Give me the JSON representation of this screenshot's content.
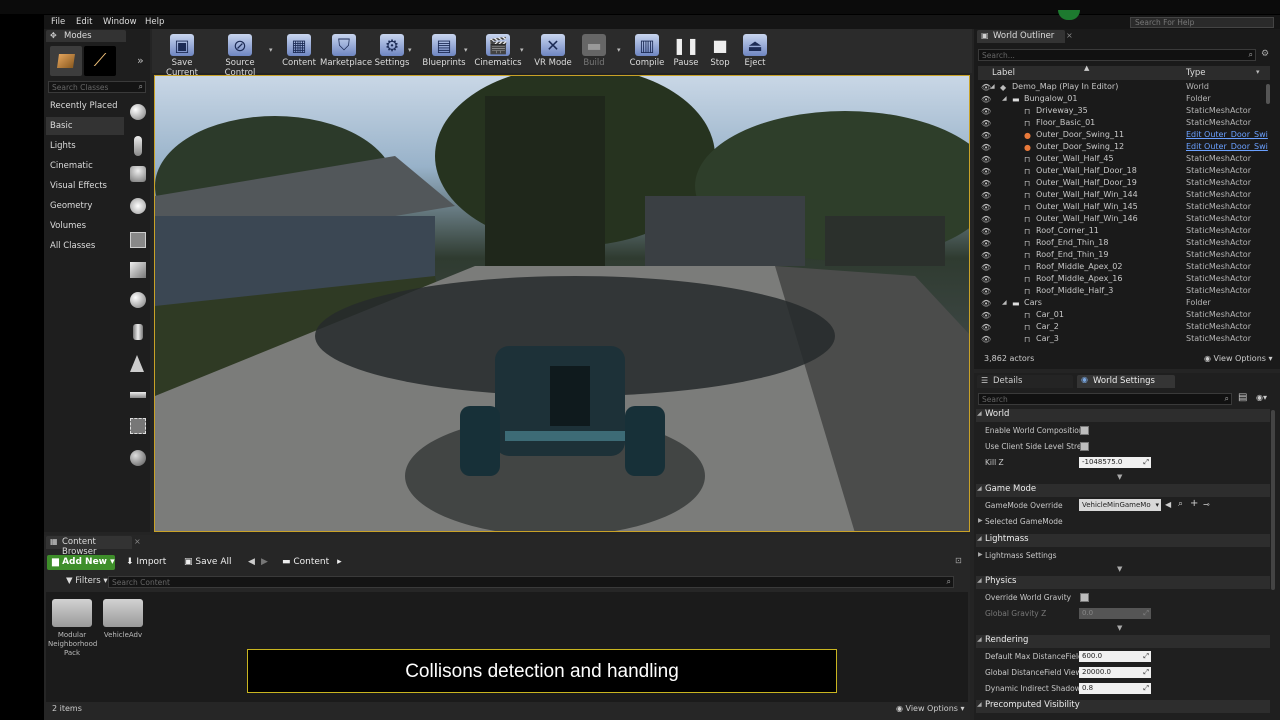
{
  "menu": [
    "File",
    "Edit",
    "Window",
    "Help"
  ],
  "search_help": {
    "placeholder": "Search For Help"
  },
  "modes": {
    "tab": "Modes",
    "search_placeholder": "Search Classes",
    "items": [
      "Recently Placed",
      "Basic",
      "Lights",
      "Cinematic",
      "Visual Effects",
      "Geometry",
      "Volumes",
      "All Classes"
    ]
  },
  "toolbar": {
    "save": "Save Current",
    "source_control": "Source Control",
    "content": "Content",
    "marketplace": "Marketplace",
    "settings": "Settings",
    "blueprints": "Blueprints",
    "cinematics": "Cinematics",
    "vr_mode": "VR Mode",
    "build": "Build",
    "compile": "Compile",
    "pause": "Pause",
    "stop": "Stop",
    "eject": "Eject"
  },
  "outliner": {
    "tab": "World Outliner",
    "search_placeholder": "Search...",
    "col_label": "Label",
    "col_type": "Type",
    "rows": [
      {
        "label": "Demo_Map (Play In Editor)",
        "type": "World",
        "indent": 0,
        "icon": "world-icon",
        "link": false
      },
      {
        "label": "Bungalow_01",
        "type": "Folder",
        "indent": 1,
        "icon": "folder-icon",
        "link": false
      },
      {
        "label": "Driveway_35",
        "type": "StaticMeshActor",
        "indent": 2,
        "icon": "mesh-icon",
        "link": false
      },
      {
        "label": "Floor_Basic_01",
        "type": "StaticMeshActor",
        "indent": 2,
        "icon": "mesh-icon",
        "link": false
      },
      {
        "label": "Outer_Door_Swing_11",
        "type": "Edit Outer_Door_Swi",
        "indent": 2,
        "icon": "blueprint-icon",
        "link": true
      },
      {
        "label": "Outer_Door_Swing_12",
        "type": "Edit Outer_Door_Swi",
        "indent": 2,
        "icon": "blueprint-icon",
        "link": true
      },
      {
        "label": "Outer_Wall_Half_45",
        "type": "StaticMeshActor",
        "indent": 2,
        "icon": "mesh-icon",
        "link": false
      },
      {
        "label": "Outer_Wall_Half_Door_18",
        "type": "StaticMeshActor",
        "indent": 2,
        "icon": "mesh-icon",
        "link": false
      },
      {
        "label": "Outer_Wall_Half_Door_19",
        "type": "StaticMeshActor",
        "indent": 2,
        "icon": "mesh-icon",
        "link": false
      },
      {
        "label": "Outer_Wall_Half_Win_144",
        "type": "StaticMeshActor",
        "indent": 2,
        "icon": "mesh-icon",
        "link": false
      },
      {
        "label": "Outer_Wall_Half_Win_145",
        "type": "StaticMeshActor",
        "indent": 2,
        "icon": "mesh-icon",
        "link": false
      },
      {
        "label": "Outer_Wall_Half_Win_146",
        "type": "StaticMeshActor",
        "indent": 2,
        "icon": "mesh-icon",
        "link": false
      },
      {
        "label": "Roof_Corner_11",
        "type": "StaticMeshActor",
        "indent": 2,
        "icon": "mesh-icon",
        "link": false
      },
      {
        "label": "Roof_End_Thin_18",
        "type": "StaticMeshActor",
        "indent": 2,
        "icon": "mesh-icon",
        "link": false
      },
      {
        "label": "Roof_End_Thin_19",
        "type": "StaticMeshActor",
        "indent": 2,
        "icon": "mesh-icon",
        "link": false
      },
      {
        "label": "Roof_Middle_Apex_02",
        "type": "StaticMeshActor",
        "indent": 2,
        "icon": "mesh-icon",
        "link": false
      },
      {
        "label": "Roof_Middle_Apex_16",
        "type": "StaticMeshActor",
        "indent": 2,
        "icon": "mesh-icon",
        "link": false
      },
      {
        "label": "Roof_Middle_Half_3",
        "type": "StaticMeshActor",
        "indent": 2,
        "icon": "mesh-icon",
        "link": false
      },
      {
        "label": "Cars",
        "type": "Folder",
        "indent": 1,
        "icon": "folder-icon",
        "link": false
      },
      {
        "label": "Car_01",
        "type": "StaticMeshActor",
        "indent": 2,
        "icon": "mesh-icon",
        "link": false
      },
      {
        "label": "Car_2",
        "type": "StaticMeshActor",
        "indent": 2,
        "icon": "mesh-icon",
        "link": false
      },
      {
        "label": "Car_3",
        "type": "StaticMeshActor",
        "indent": 2,
        "icon": "mesh-icon",
        "link": false
      }
    ],
    "actor_count": "3,862 actors",
    "view_options": "View Options"
  },
  "details": {
    "tab_details": "Details",
    "tab_world_settings": "World Settings",
    "search_placeholder": "Search",
    "sections": {
      "world": "World",
      "game_mode": "Game Mode",
      "lightmass": "Lightmass",
      "physics": "Physics",
      "rendering": "Rendering",
      "precomputed": "Precomputed Visibility"
    },
    "props": {
      "enable_world_composition": "Enable World Composition",
      "use_client_side": "Use Client Side Level Strea",
      "kill_z": "Kill Z",
      "kill_z_value": "-1048575.0",
      "gamemode_override": "GameMode Override",
      "gamemode_value": "VehicleMinGameMo",
      "selected_gamemode": "Selected GameMode",
      "lightmass_settings": "Lightmass Settings",
      "override_gravity": "Override World Gravity",
      "global_gravity": "Global Gravity Z",
      "global_gravity_value": "0.0",
      "default_max_df": "Default Max DistanceField",
      "default_max_df_value": "600.0",
      "global_df_view": "Global DistanceField View I",
      "global_df_view_value": "20000.0",
      "dyn_indirect": "Dynamic Indirect Shadows",
      "dyn_indirect_value": "0.8"
    }
  },
  "content_browser": {
    "tab": "Content Browser",
    "add_new": "Add New",
    "import": "Import",
    "save_all": "Save All",
    "path": "Content",
    "filters": "Filters",
    "search_placeholder": "Search Content",
    "folders": [
      "Modular Neighborhood Pack",
      "VehicleAdv"
    ],
    "item_count": "2 items",
    "view_options": "View Options"
  },
  "caption": "Collisons detection and handling"
}
